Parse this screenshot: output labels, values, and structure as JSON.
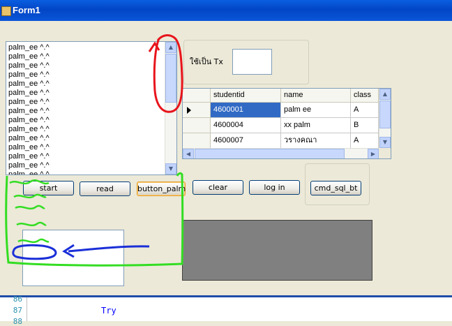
{
  "window": {
    "title": "Form1"
  },
  "listbox": {
    "items": [
      "palm_ee ^.^",
      "palm_ee ^.^",
      "palm_ee ^.^",
      "palm_ee ^.^",
      "palm_ee ^.^",
      "palm_ee ^.^",
      "palm_ee ^.^",
      "palm_ee ^.^",
      "palm_ee ^.^",
      "palm_ee ^.^",
      "palm_ee ^.^",
      "palm_ee ^.^",
      "palm_ee ^.^",
      "palm_ee ^.^",
      "palm_ee ^.^"
    ]
  },
  "tx_group": {
    "label": "ใช้เป็น Tx",
    "value": ""
  },
  "grid": {
    "columns": [
      "studentid",
      "name",
      "class"
    ],
    "rows": [
      [
        "4600001",
        "palm ee",
        "A"
      ],
      [
        "4600004",
        "xx palm",
        "B"
      ],
      [
        "4600007",
        "วรางคณา",
        "A"
      ]
    ],
    "selected_row": 0
  },
  "buttons": {
    "start": "start",
    "read": "read",
    "button_palm": "button_palm",
    "clear": "clear",
    "login": "log in",
    "cmd_sql": "cmd_sql_bt"
  },
  "code": {
    "line_numbers": [
      "86",
      "87",
      "88"
    ],
    "line_text": "Try"
  },
  "colors": {
    "titlebar": "#0a55d8",
    "selection": "#316ac5",
    "annotation_red": "#e8141c",
    "annotation_green": "#33dd22",
    "annotation_blue": "#1a2fd8"
  }
}
